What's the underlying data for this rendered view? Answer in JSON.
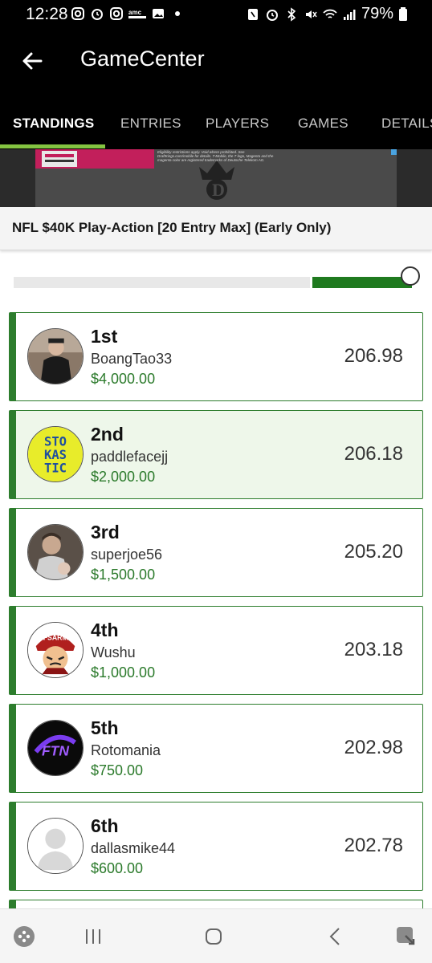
{
  "status_bar": {
    "time": "12:28",
    "battery": "79%",
    "left_icons": [
      "instagram-icon",
      "alarm-icon",
      "instagram-icon",
      "amc-icon",
      "gallery-icon",
      "dot-icon"
    ],
    "right_icons": [
      "nfc-icon",
      "alarm-icon",
      "bluetooth-icon",
      "mute-icon",
      "wifi-icon",
      "signal-icon",
      "battery-icon"
    ]
  },
  "app_bar": {
    "title": "GameCenter",
    "back_icon": "back-arrow-icon"
  },
  "tabs": [
    {
      "label": "STANDINGS",
      "active": true
    },
    {
      "label": "ENTRIES",
      "active": false
    },
    {
      "label": "PLAYERS",
      "active": false
    },
    {
      "label": "GAMES",
      "active": false
    },
    {
      "label": "DETAILS",
      "active": false
    }
  ],
  "ad": {
    "text": "Eligibility restrictions apply. Void where prohibited. See DraftKings.com/mobile for details. T-Mobile, the T logo, Magenta and the magenta color are registered trademarks of Deutsche Telekom AG."
  },
  "contest": {
    "title": "NFL $40K Play-Action [20 Entry Max] (Early Only)"
  },
  "progress": {
    "value": 0.76
  },
  "standings": [
    {
      "rank": "1st",
      "username": "BoangTao33",
      "prize": "$4,000.00",
      "score": "206.98",
      "avatar": "photo-avatar",
      "highlighted": false
    },
    {
      "rank": "2nd",
      "username": "paddlefacejj",
      "prize": "$2,000.00",
      "score": "206.18",
      "avatar": "stokastic-logo-avatar",
      "highlighted": true
    },
    {
      "rank": "3rd",
      "username": "superjoe56",
      "prize": "$1,500.00",
      "score": "205.20",
      "avatar": "photo-avatar",
      "highlighted": false
    },
    {
      "rank": "4th",
      "username": "Wushu",
      "prize": "$1,000.00",
      "score": "203.18",
      "avatar": "dfsarmy-logo-avatar",
      "highlighted": false
    },
    {
      "rank": "5th",
      "username": "Rotomania",
      "prize": "$750.00",
      "score": "202.98",
      "avatar": "ftn-logo-avatar",
      "highlighted": false
    },
    {
      "rank": "6th",
      "username": "dallasmike44",
      "prize": "$600.00",
      "score": "202.78",
      "avatar": "default-avatar",
      "highlighted": false
    }
  ],
  "logos": {
    "stokastic": [
      "STO",
      "KAS",
      "TIC"
    ],
    "dfsarmy": "DFSARMY",
    "ftn": "FTN"
  },
  "bottom_nav": [
    "game-launcher-icon",
    "recent-apps-icon",
    "home-icon",
    "back-icon",
    "assistant-icon"
  ],
  "colors": {
    "accent_green": "#2d7d2d",
    "tab_indicator": "#84c441",
    "prize_green": "#2b7a2b",
    "highlight_bg": "#eef7ea"
  }
}
